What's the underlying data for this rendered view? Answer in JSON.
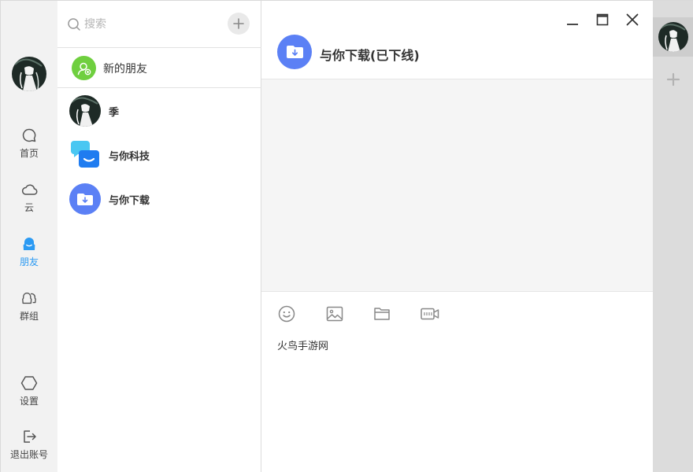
{
  "nav": {
    "items": [
      {
        "label": "首页",
        "icon": "chat-bubble-icon"
      },
      {
        "label": "云",
        "icon": "cloud-icon"
      },
      {
        "label": "朋友",
        "icon": "friend-icon",
        "active": true
      },
      {
        "label": "群组",
        "icon": "group-icon"
      },
      {
        "label": "设置",
        "icon": "hexagon-settings-icon"
      },
      {
        "label": "退出账号",
        "icon": "logout-icon"
      }
    ]
  },
  "contacts": {
    "search_placeholder": "搜索",
    "new_friends_label": "新的朋友",
    "items": [
      {
        "name": "季",
        "avatar": "user-photo-avatar"
      },
      {
        "name": "与你科技",
        "avatar": "chat-bubbles-avatar"
      },
      {
        "name": "与你下载",
        "avatar": "folder-download-avatar"
      }
    ]
  },
  "chat": {
    "title": "与你下载(已下线)",
    "compose_text": "火鸟手游网"
  },
  "colors": {
    "accent": "#2b9af3",
    "new_friend_green": "#6fcf3f",
    "download_blue": "#5b80f5",
    "nav_bg": "#f2f2f2",
    "strip_bg": "#dcdcdc"
  }
}
